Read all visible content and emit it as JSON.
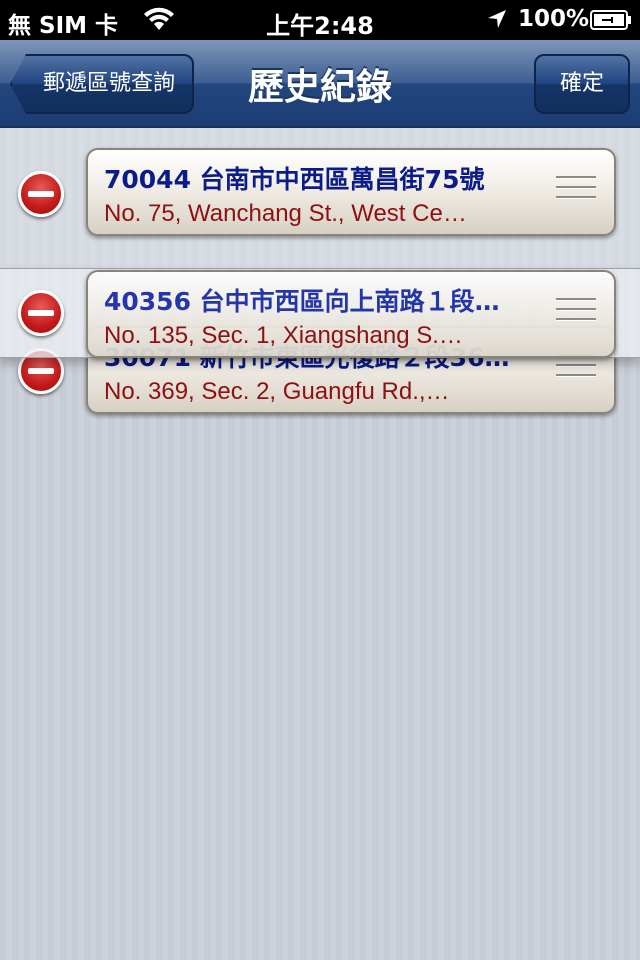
{
  "status_bar": {
    "carrier": "無 SIM 卡",
    "time": "上午2:48",
    "battery": "100%"
  },
  "nav_bar": {
    "back_label": "郵遞區號查詢",
    "title": "歷史紀錄",
    "confirm_label": "確定"
  },
  "history": [
    {
      "line1": "70044 台南市中西區萬昌街75號",
      "line2": "No. 75, Wanchang St., West Ce…"
    },
    {
      "line1": "40356 台中市西區向上南路１段…",
      "line2": "No. 135, Sec. 1, Xiangshang S.…"
    },
    {
      "line1": "30071 新竹市東區光復路２段36…",
      "line2": "No. 369, Sec. 2, Guangfu Rd.,…"
    }
  ],
  "colors": {
    "nav": "#23467e",
    "line1_text": "#0b1c8a",
    "line2_text": "#8e1010",
    "delete": "#c41a1a"
  }
}
